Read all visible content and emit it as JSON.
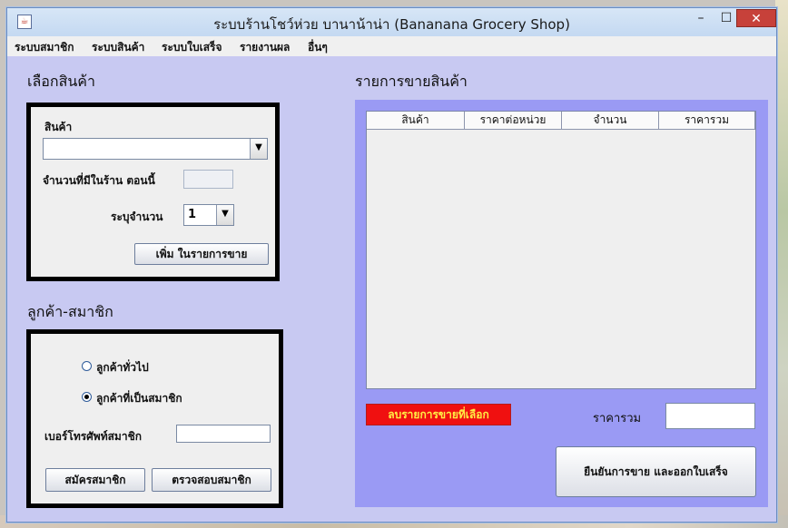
{
  "window": {
    "title": "ระบบร้านโชว์ห่วย บานาน้าน่า (Bananana Grocery Shop)",
    "minimize_symbol": "–",
    "maximize_symbol": "☐",
    "close_symbol": "✕"
  },
  "menu": [
    {
      "label": "ระบบสมาชิก"
    },
    {
      "label": "ระบบสินค้า"
    },
    {
      "label": "ระบบใบเสร็จ"
    },
    {
      "label": "รายงานผล"
    },
    {
      "label": "อื่นๆ"
    }
  ],
  "select_product": {
    "section_title": "เลือกสินค้า",
    "product_label": "สินค้า",
    "product_value": "",
    "stock_label": "จำนวนที่มีในร้าน ตอนนี้",
    "stock_value": "",
    "qty_label": "ระบุจำนวน",
    "qty_value": "1",
    "add_button": "เพิ่ม ในรายการขาย"
  },
  "customer": {
    "section_title": "ลูกค้า-สมาชิก",
    "radio_general": "ลูกค้าทั่วไป",
    "radio_member": "ลูกค้าที่เป็นสมาชิก",
    "selected": "member",
    "phone_label": "เบอร์โทรศัพท์สมาชิก",
    "phone_value": "",
    "register_button": "สมัครสมาชิก",
    "check_button": "ตรวจสอบสมาชิก"
  },
  "sales": {
    "section_title": "รายการขายสินค้า",
    "columns": [
      "สินค้า",
      "ราคาต่อหน่วย",
      "จำนวน",
      "ราคารวม"
    ],
    "rows": [],
    "delete_button": "ลบรายการขายที่เลือก",
    "total_label": "ราคารวม",
    "total_value": "",
    "confirm_button": "ยืนยันการขาย และออกใบเสร็จ"
  },
  "colors": {
    "panel_bg": "#c8c9f2",
    "sales_panel_bg": "#9a9af4",
    "delete_button_bg": "#f01010",
    "delete_button_text": "#ffee44",
    "close_button_bg": "#c7413a"
  }
}
